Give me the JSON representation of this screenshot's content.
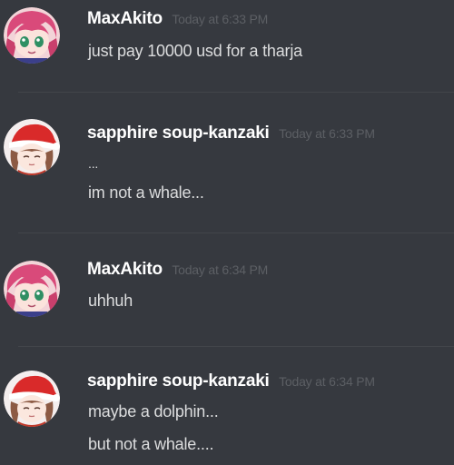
{
  "colors": {
    "background": "#36393f",
    "username": "#ffffff",
    "timestamp": "#5c5f64",
    "message_text": "#dcddde",
    "divider": "#42454a"
  },
  "messages": [
    {
      "author": "MaxAkito",
      "timestamp": "Today at 6:33 PM",
      "avatar_icon": "anime-girl-pink-hair-avatar",
      "lines": [
        "just pay 10000 usd for a tharja"
      ]
    },
    {
      "author": "sapphire soup-kanzaki",
      "timestamp": "Today at 6:33 PM",
      "avatar_icon": "santa-hat-girl-avatar",
      "lines": [
        "...",
        "im not a whale..."
      ]
    },
    {
      "author": "MaxAkito",
      "timestamp": "Today at 6:34 PM",
      "avatar_icon": "anime-girl-pink-hair-avatar",
      "lines": [
        "uhhuh"
      ]
    },
    {
      "author": "sapphire soup-kanzaki",
      "timestamp": "Today at 6:34 PM",
      "avatar_icon": "santa-hat-girl-avatar",
      "lines": [
        "maybe a dolphin...",
        "but not a whale...."
      ]
    }
  ]
}
